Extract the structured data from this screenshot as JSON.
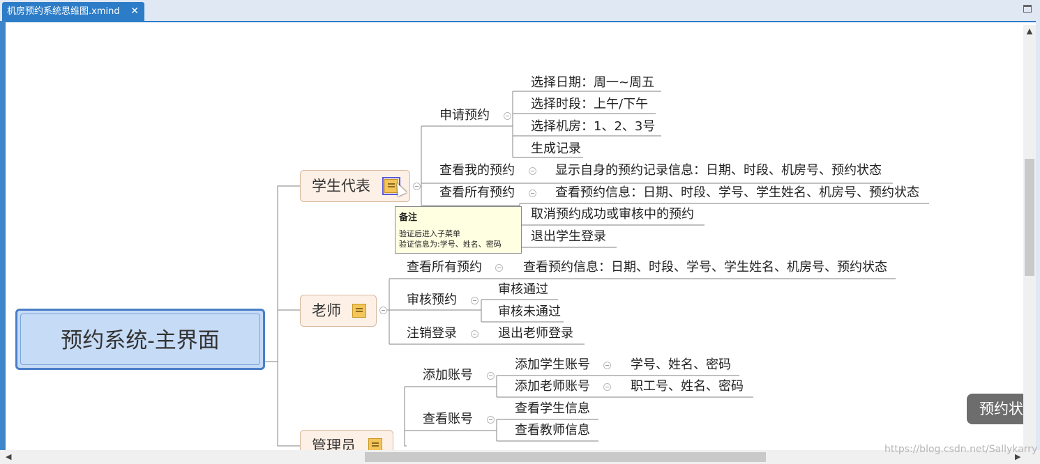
{
  "tab": {
    "title": "机房预约系统思维图.xmind",
    "close_icon": "close-icon"
  },
  "root": {
    "label": "预约系统-主界面"
  },
  "student": {
    "label": "学生代表",
    "apply": {
      "label": "申请预约",
      "children": [
        "选择日期：周一~周五",
        "选择时段：上午/下午",
        "选择机房：1、2、3号",
        "生成记录"
      ]
    },
    "view_mine": {
      "label": "查看我的预约",
      "detail": "显示自身的预约记录信息：日期、时段、机房号、预约状态"
    },
    "view_all": {
      "label": "查看所有预约",
      "detail": "查看预约信息：日期、时段、学号、学生姓名、机房号、预约状态"
    },
    "cancel": "取消预约成功或审核中的预约",
    "logout": "退出学生登录"
  },
  "tooltip": {
    "title": "备注",
    "line1": "验证后进入子菜单",
    "line2": "验证信息为:学号、姓名、密码"
  },
  "teacher": {
    "label": "老师",
    "view_all": {
      "label": "查看所有预约",
      "detail": "查看预约信息：日期、时段、学号、学生姓名、机房号、预约状态"
    },
    "review": {
      "label": "审核预约",
      "children": [
        "审核通过",
        "审核未通过"
      ]
    },
    "logout": {
      "label": "注销登录",
      "detail": "退出老师登录"
    }
  },
  "admin": {
    "label": "管理员",
    "add": {
      "label": "添加账号",
      "student": {
        "label": "添加学生账号",
        "detail": "学号、姓名、密码"
      },
      "teacher": {
        "label": "添加老师账号",
        "detail": "职工号、姓名、密码"
      }
    },
    "view": {
      "label": "查看账号",
      "children": [
        "查看学生信息",
        "查看教师信息"
      ]
    }
  },
  "float_button": "预约状",
  "watermark": "https://blog.csdn.net/Sallykarry"
}
